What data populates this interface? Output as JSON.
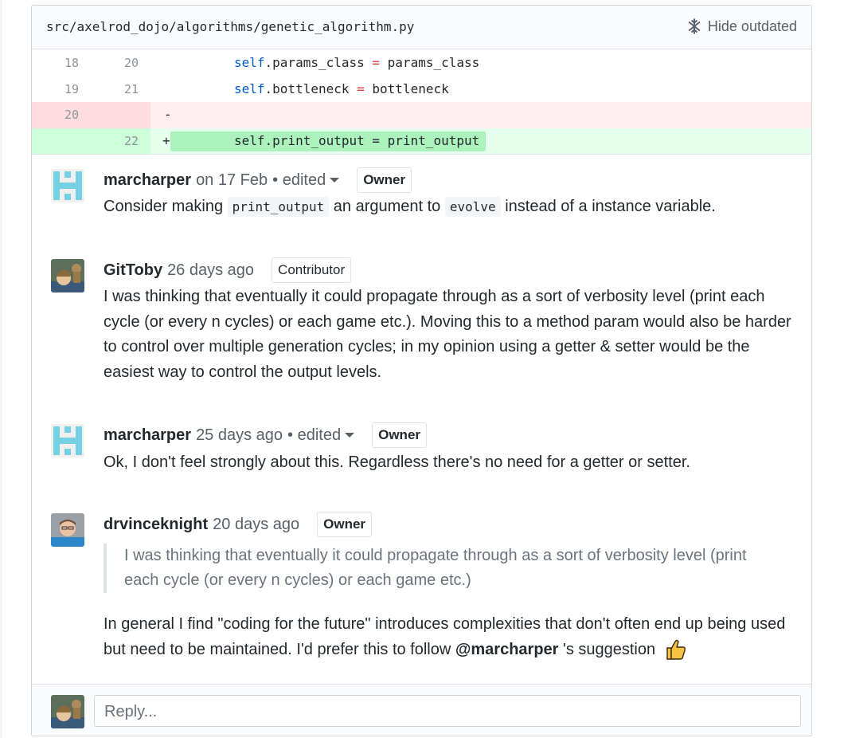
{
  "file": {
    "path": "src/axelrod_dojo/algorithms/genetic_algorithm.py",
    "hide_outdated_label": "Hide outdated"
  },
  "diff": {
    "rows": [
      {
        "old": "18",
        "new": "20",
        "type": "context",
        "text": "self.params_class = params_class"
      },
      {
        "old": "19",
        "new": "21",
        "type": "context",
        "text": "self.bottleneck = bottleneck"
      },
      {
        "old": "20",
        "new": "",
        "type": "deletion",
        "sign": "-",
        "text": ""
      },
      {
        "old": "",
        "new": "22",
        "type": "addition",
        "sign": "+",
        "text": "self.print_output = print_output"
      }
    ]
  },
  "comments": [
    {
      "author": "marcharper",
      "time": "on 17 Feb",
      "edited": "• edited",
      "badge": "Owner",
      "body_parts": [
        "Consider making ",
        "print_output",
        " an argument to ",
        "evolve",
        " instead of a instance variable."
      ]
    },
    {
      "author": "GitToby",
      "time": "26 days ago",
      "badge": "Contributor",
      "body": "I was thinking that eventually it could propagate through as a sort of verbosity level (print each cycle (or every n cycles) or each game etc.). Moving this to a method param would also be harder to control over multiple generation cycles; in my opinion using a getter & setter would be the easiest way to control the output levels."
    },
    {
      "author": "marcharper",
      "time": "25 days ago",
      "edited": "• edited",
      "badge": "Owner",
      "body": "Ok, I don't feel strongly about this. Regardless there's no need for a getter or setter."
    },
    {
      "author": "drvinceknight",
      "time": "20 days ago",
      "badge": "Owner",
      "quote": "I was thinking that eventually it could propagate through as a sort of verbosity level (print each cycle (or every n cycles) or each game etc.)",
      "body_before": "In general I find \"coding for the future\" introduces complexities that don't often end up being used but need to be maintained. I'd prefer this to follow ",
      "mention": "@marcharper",
      "body_after": " 's suggestion",
      "emoji": "thumbs-up"
    }
  ],
  "reply": {
    "placeholder": "Reply..."
  },
  "colors": {
    "deletion_bg": "#ffeef0",
    "addition_bg": "#e6ffed",
    "identicon": "#76d0e3"
  }
}
